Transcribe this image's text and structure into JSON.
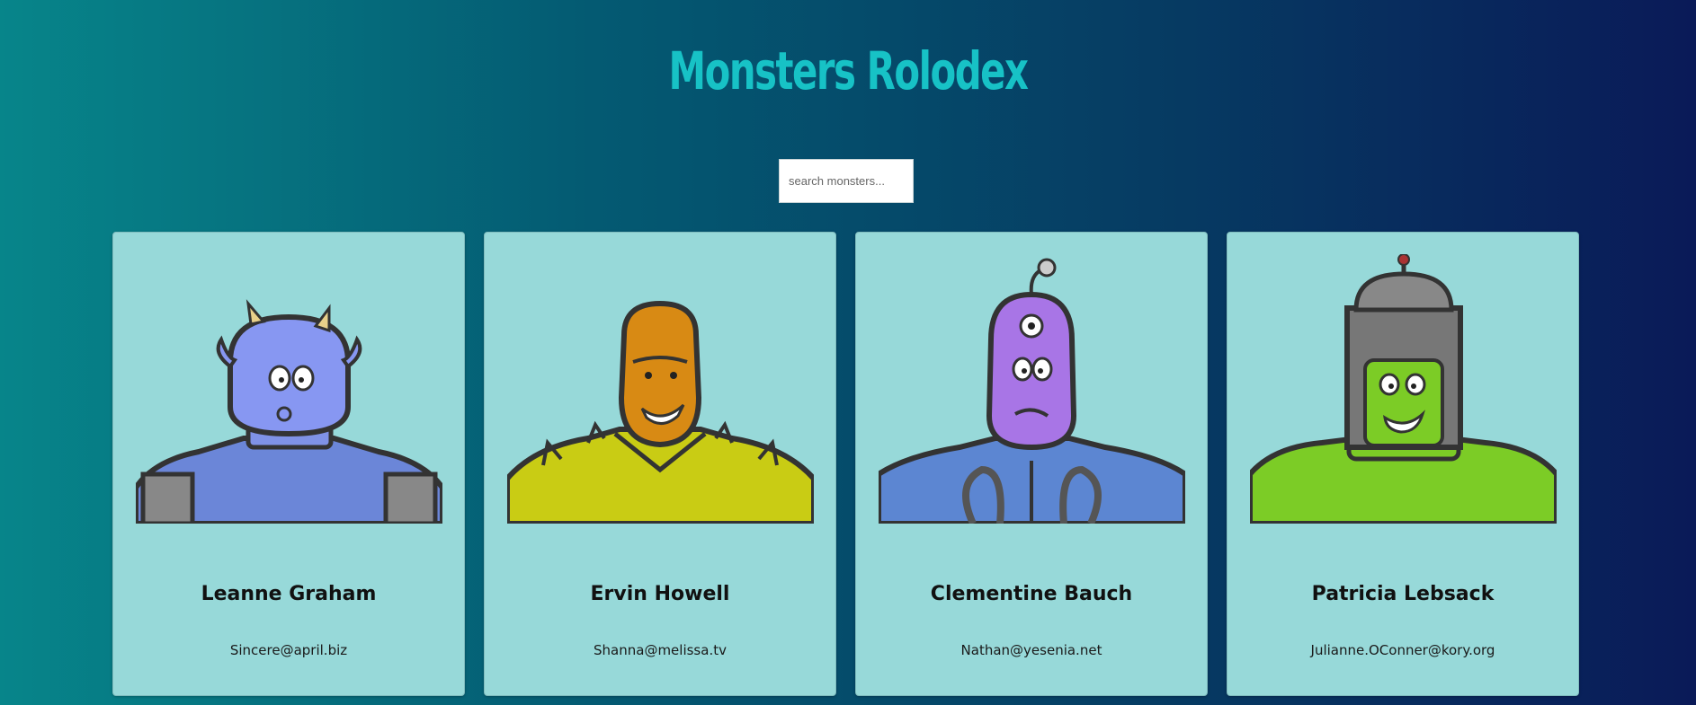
{
  "app": {
    "title": "Monsters Rolodex"
  },
  "search": {
    "placeholder": "search monsters...",
    "value": ""
  },
  "monsters": [
    {
      "name": "Leanne Graham",
      "email": "Sincere@april.biz",
      "skin": "#8797f2",
      "body": "#6b86d8"
    },
    {
      "name": "Ervin Howell",
      "email": "Shanna@melissa.tv",
      "skin": "#d88a14",
      "body": "#c9cc14"
    },
    {
      "name": "Clementine Bauch",
      "email": "Nathan@yesenia.net",
      "skin": "#a875e6",
      "body": "#5c86d2"
    },
    {
      "name": "Patricia Lebsack",
      "email": "Julianne.OConner@kory.org",
      "skin": "#7ccc26",
      "body": "#7ccc26"
    }
  ]
}
